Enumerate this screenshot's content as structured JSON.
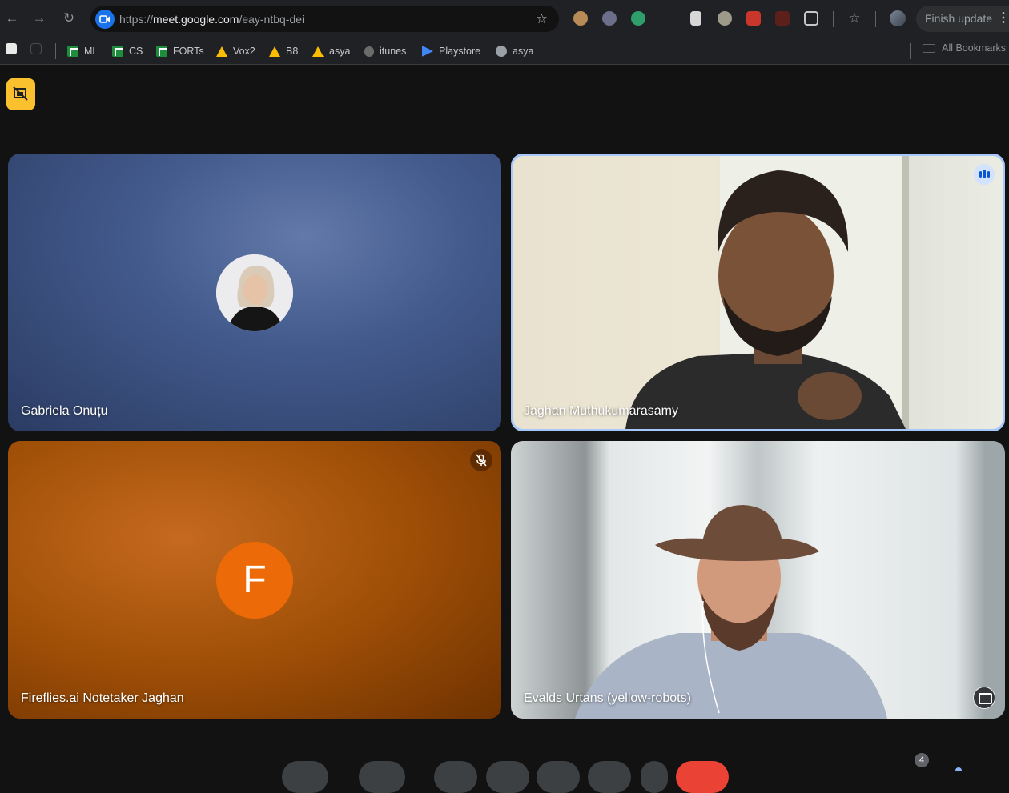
{
  "browser": {
    "url_scheme": "https://",
    "url_host": "meet.google.com",
    "url_path": "/eay-ntbq-dei",
    "finish_update_label": "Finish update"
  },
  "bookmarks": [
    {
      "label": "ML",
      "icon": "sheets-icon"
    },
    {
      "label": "CS",
      "icon": "sheets-icon"
    },
    {
      "label": "FORTs",
      "icon": "sheets-icon"
    },
    {
      "label": "Vox2",
      "icon": "drive-icon"
    },
    {
      "label": "B8",
      "icon": "drive-icon"
    },
    {
      "label": "asya",
      "icon": "drive-icon"
    },
    {
      "label": "itunes",
      "icon": "apple-icon"
    },
    {
      "label": "Playstore",
      "icon": "play-icon"
    },
    {
      "label": "asya",
      "icon": "globe-icon"
    }
  ],
  "all_bookmarks_label": "All Bookmarks",
  "participants": [
    {
      "name": "Gabriela Onuțu",
      "display": "avatar-photo"
    },
    {
      "name": "Jaghan Muthukumarasamy",
      "display": "video",
      "speaking": true
    },
    {
      "name": "Fireflies.ai Notetaker Jaghan",
      "display": "avatar-letter",
      "avatar_letter": "F",
      "muted": true,
      "avatar_color": "#ec6b08"
    },
    {
      "name": "Evalds Urtans (yellow-robots)",
      "display": "video"
    }
  ],
  "people_count": "4",
  "colors": {
    "speaking_border": "#a8c7fa",
    "pin_button": "#fbc02d",
    "end_call": "#ea4335"
  }
}
